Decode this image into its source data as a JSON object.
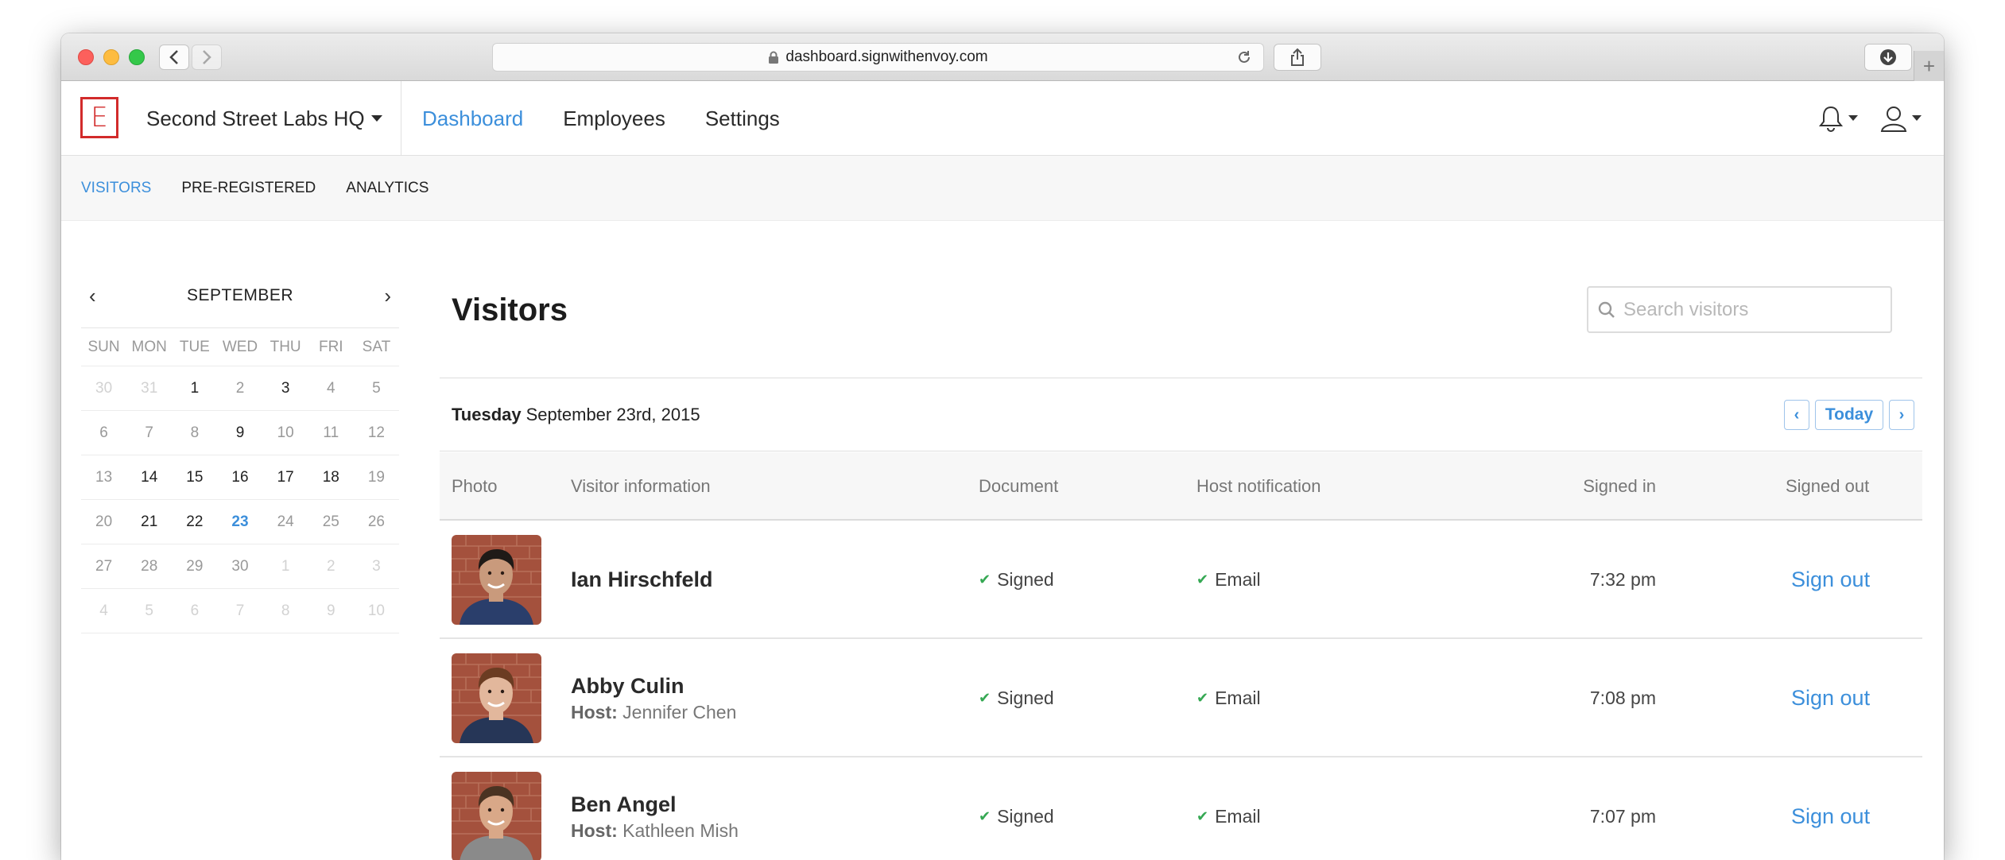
{
  "browser": {
    "url": "dashboard.signwithenvoy.com"
  },
  "header": {
    "logo_letter": "E",
    "org_name": "Second Street Labs HQ",
    "nav": [
      {
        "label": "Dashboard",
        "active": true
      },
      {
        "label": "Employees",
        "active": false
      },
      {
        "label": "Settings",
        "active": false
      }
    ],
    "icons": [
      "bell-icon",
      "user-icon"
    ]
  },
  "subnav": [
    {
      "label": "VISITORS",
      "active": true
    },
    {
      "label": "PRE-REGISTERED",
      "active": false
    },
    {
      "label": "ANALYTICS",
      "active": false
    }
  ],
  "calendar": {
    "month": "SEPTEMBER",
    "prev": "‹",
    "next": "›",
    "weekdays": [
      "SUN",
      "MON",
      "TUE",
      "WED",
      "THU",
      "FRI",
      "SAT"
    ],
    "weeks": [
      [
        {
          "d": "30",
          "s": "muted"
        },
        {
          "d": "31",
          "s": "muted"
        },
        {
          "d": "1",
          "s": "bold"
        },
        {
          "d": "2",
          "s": "normal"
        },
        {
          "d": "3",
          "s": "bold"
        },
        {
          "d": "4",
          "s": "normal"
        },
        {
          "d": "5",
          "s": "normal"
        }
      ],
      [
        {
          "d": "6",
          "s": "normal"
        },
        {
          "d": "7",
          "s": "normal"
        },
        {
          "d": "8",
          "s": "normal"
        },
        {
          "d": "9",
          "s": "bold"
        },
        {
          "d": "10",
          "s": "normal"
        },
        {
          "d": "11",
          "s": "normal"
        },
        {
          "d": "12",
          "s": "normal"
        }
      ],
      [
        {
          "d": "13",
          "s": "normal"
        },
        {
          "d": "14",
          "s": "bold"
        },
        {
          "d": "15",
          "s": "bold"
        },
        {
          "d": "16",
          "s": "bold"
        },
        {
          "d": "17",
          "s": "bold"
        },
        {
          "d": "18",
          "s": "bold"
        },
        {
          "d": "19",
          "s": "normal"
        }
      ],
      [
        {
          "d": "20",
          "s": "normal"
        },
        {
          "d": "21",
          "s": "bold"
        },
        {
          "d": "22",
          "s": "bold"
        },
        {
          "d": "23",
          "s": "today"
        },
        {
          "d": "24",
          "s": "normal"
        },
        {
          "d": "25",
          "s": "normal"
        },
        {
          "d": "26",
          "s": "normal"
        }
      ],
      [
        {
          "d": "27",
          "s": "normal"
        },
        {
          "d": "28",
          "s": "normal"
        },
        {
          "d": "29",
          "s": "normal"
        },
        {
          "d": "30",
          "s": "normal"
        },
        {
          "d": "1",
          "s": "muted"
        },
        {
          "d": "2",
          "s": "muted"
        },
        {
          "d": "3",
          "s": "muted"
        }
      ],
      [
        {
          "d": "4",
          "s": "muted"
        },
        {
          "d": "5",
          "s": "muted"
        },
        {
          "d": "6",
          "s": "muted"
        },
        {
          "d": "7",
          "s": "muted"
        },
        {
          "d": "8",
          "s": "muted"
        },
        {
          "d": "9",
          "s": "muted"
        },
        {
          "d": "10",
          "s": "muted"
        }
      ]
    ]
  },
  "main": {
    "title": "Visitors",
    "search_placeholder": "Search visitors",
    "date_dow": "Tuesday",
    "date_rest": "September 23rd, 2015",
    "date_prev": "‹",
    "date_today": "Today",
    "date_next": "›",
    "columns": {
      "photo": "Photo",
      "visitor": "Visitor information",
      "document": "Document",
      "host_notification": "Host notification",
      "signed_in": "Signed in",
      "signed_out": "Signed out"
    },
    "host_label": "Host:",
    "rows": [
      {
        "name": "Ian Hirschfeld",
        "host": "",
        "document": "Signed",
        "notification": "Email",
        "signed_in": "7:32 pm",
        "signed_out": "Sign out",
        "skin": "#c99a7c",
        "hair": "#1f1a17",
        "shirt": "#2a3e6b"
      },
      {
        "name": "Abby Culin",
        "host": "Jennifer Chen",
        "document": "Signed",
        "notification": "Email",
        "signed_in": "7:08 pm",
        "signed_out": "Sign out",
        "skin": "#e2b79c",
        "hair": "#6b3c22",
        "shirt": "#263657"
      },
      {
        "name": "Ben Angel",
        "host": "Kathleen Mish",
        "document": "Signed",
        "notification": "Email",
        "signed_in": "7:07 pm",
        "signed_out": "Sign out",
        "skin": "#d9a888",
        "hair": "#4a3322",
        "shirt": "#8a8a8a"
      }
    ]
  },
  "colors": {
    "accent": "#3c8fdb",
    "brand_red": "#d22b2b",
    "check_green": "#35a853",
    "brick": "#a4513d"
  }
}
